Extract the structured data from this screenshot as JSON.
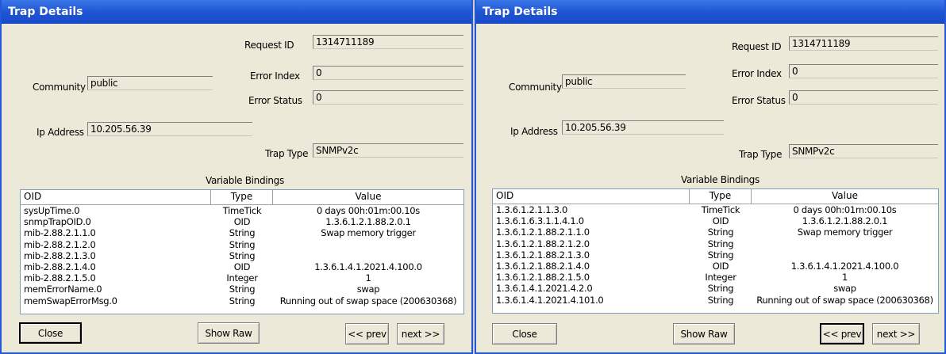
{
  "windows": [
    {
      "title": "Trap Details",
      "labels": {
        "request_id": "Request ID",
        "error_index": "Error Index",
        "error_status": "Error Status",
        "community": "Community",
        "ip_address": "Ip Address",
        "trap_type": "Trap Type",
        "variable_bindings": "Variable Bindings"
      },
      "values": {
        "request_id": "1314711189",
        "error_index": "0",
        "error_status": "0",
        "community": "public",
        "ip_address": "10.205.56.39",
        "trap_type": "SNMPv2c"
      },
      "columns": [
        "OID",
        "Type",
        "Value"
      ],
      "rows": [
        {
          "oid": "sysUpTime.0",
          "type": "TimeTick",
          "value": "0 days 00h:01m:00.10s"
        },
        {
          "oid": "snmpTrapOID.0",
          "type": "OID",
          "value": "1.3.6.1.2.1.88.2.0.1"
        },
        {
          "oid": "mib-2.88.2.1.1.0",
          "type": "String",
          "value": "Swap memory trigger"
        },
        {
          "oid": "mib-2.88.2.1.2.0",
          "type": "String",
          "value": ""
        },
        {
          "oid": "mib-2.88.2.1.3.0",
          "type": "String",
          "value": ""
        },
        {
          "oid": "mib-2.88.2.1.4.0",
          "type": "OID",
          "value": "1.3.6.1.4.1.2021.4.100.0"
        },
        {
          "oid": "mib-2.88.2.1.5.0",
          "type": "Integer",
          "value": "1"
        },
        {
          "oid": "memErrorName.0",
          "type": "String",
          "value": "swap"
        },
        {
          "oid": "memSwapErrorMsg.0",
          "type": "String",
          "value": "Running out of swap space (200630368)"
        }
      ],
      "buttons": {
        "close": "Close",
        "show_raw": "Show Raw",
        "prev": "<< prev",
        "next": "next >>"
      }
    },
    {
      "title": "Trap Details",
      "labels": {
        "request_id": "Request ID",
        "error_index": "Error Index",
        "error_status": "Error Status",
        "community": "Community",
        "ip_address": "Ip Address",
        "trap_type": "Trap Type",
        "variable_bindings": "Variable Bindings"
      },
      "values": {
        "request_id": "1314711189",
        "error_index": "0",
        "error_status": "0",
        "community": "public",
        "ip_address": "10.205.56.39",
        "trap_type": "SNMPv2c"
      },
      "columns": [
        "OID",
        "Type",
        "Value"
      ],
      "rows": [
        {
          "oid": "1.3.6.1.2.1.1.3.0",
          "type": "TimeTick",
          "value": "0 days 00h:01m:00.10s"
        },
        {
          "oid": "1.3.6.1.6.3.1.1.4.1.0",
          "type": "OID",
          "value": "1.3.6.1.2.1.88.2.0.1"
        },
        {
          "oid": "1.3.6.1.2.1.88.2.1.1.0",
          "type": "String",
          "value": "Swap memory trigger"
        },
        {
          "oid": "1.3.6.1.2.1.88.2.1.2.0",
          "type": "String",
          "value": ""
        },
        {
          "oid": "1.3.6.1.2.1.88.2.1.3.0",
          "type": "String",
          "value": ""
        },
        {
          "oid": "1.3.6.1.2.1.88.2.1.4.0",
          "type": "OID",
          "value": "1.3.6.1.4.1.2021.4.100.0"
        },
        {
          "oid": "1.3.6.1.2.1.88.2.1.5.0",
          "type": "Integer",
          "value": "1"
        },
        {
          "oid": "1.3.6.1.4.1.2021.4.2.0",
          "type": "String",
          "value": "swap"
        },
        {
          "oid": "1.3.6.1.4.1.2021.4.101.0",
          "type": "String",
          "value": "Running out of swap space (200630368)"
        }
      ],
      "buttons": {
        "close": "Close",
        "show_raw": "Show Raw",
        "prev": "<< prev",
        "next": "next >>"
      }
    }
  ]
}
